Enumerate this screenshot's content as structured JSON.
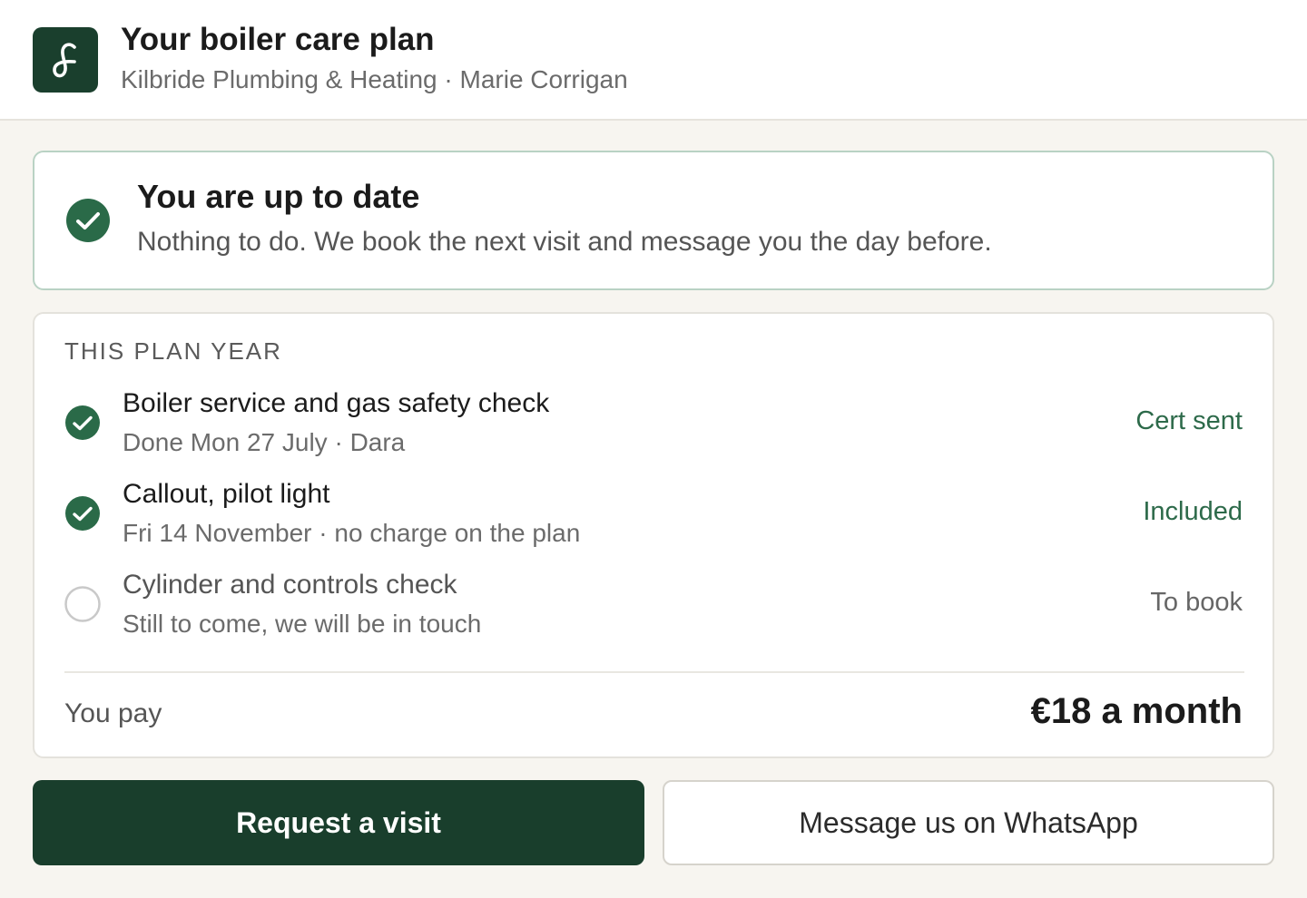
{
  "header": {
    "title": "Your boiler care plan",
    "subtitle": "Kilbride Plumbing & Heating · Marie Corrigan",
    "logo_icon": "script-f-logo-icon",
    "logo_color": "#1a3f2d"
  },
  "status": {
    "title": "You are up to date",
    "message": "Nothing to do. We book the next visit and message you the day before.",
    "icon": "check-circle-icon",
    "accent": "#2a6a48"
  },
  "plan": {
    "section_label": "THIS PLAN YEAR",
    "items": [
      {
        "title": "Boiler service and gas safety check",
        "detail": "Done Mon 27 July · Dara",
        "status": "Cert sent",
        "done": true
      },
      {
        "title": "Callout, pilot light",
        "detail": "Fri 14 November · no charge on the plan",
        "status": "Included",
        "done": true
      },
      {
        "title": "Cylinder and controls check",
        "detail": "Still to come, we will be in touch",
        "status": "To book",
        "done": false
      }
    ],
    "pay_label": "You pay",
    "pay_amount": "€18 a month"
  },
  "actions": {
    "primary_label": "Request a visit",
    "secondary_label": "Message us on WhatsApp"
  }
}
